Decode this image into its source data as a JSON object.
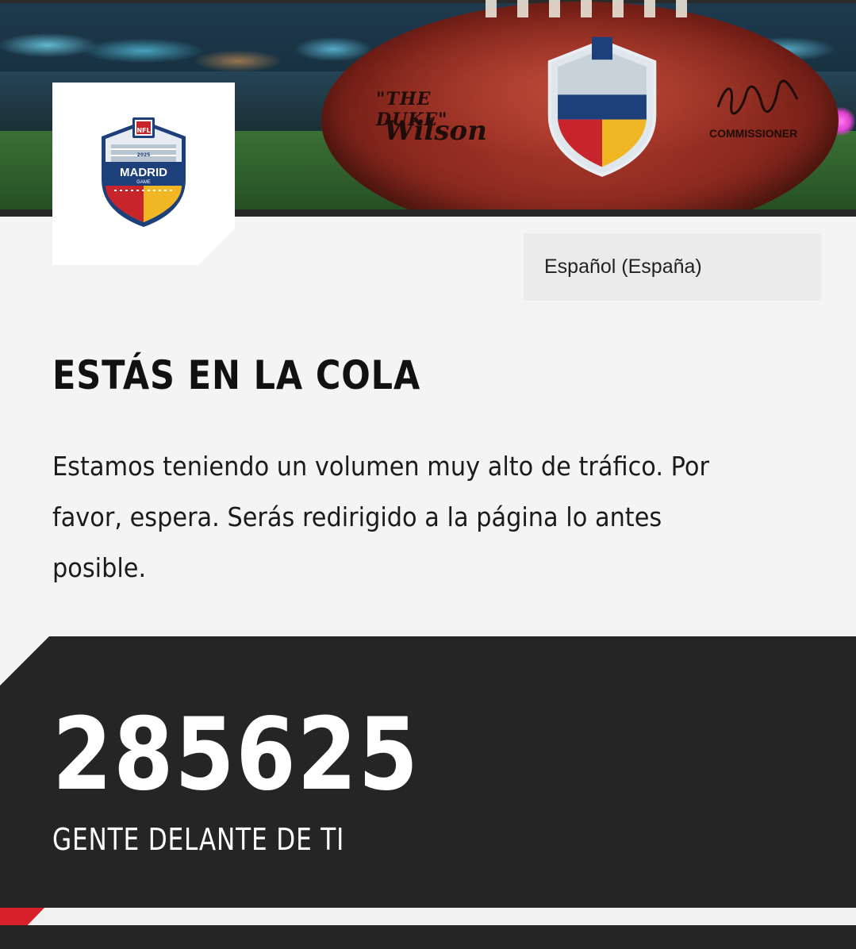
{
  "hero": {
    "ball_text_duke": "\"THE DUKE\"",
    "ball_text_wilson": "Wilson",
    "ball_text_commissioner": "COMMISSIONER"
  },
  "logo": {
    "league": "NFL",
    "year": "2025",
    "city": "MADRID",
    "subtitle": "GAME"
  },
  "language_selector": {
    "selected": "Español (España)"
  },
  "queue": {
    "title": "ESTÁS EN LA COLA",
    "message": "Estamos teniendo un volumen muy alto de tráfico. Por favor, espera. Serás redirigido a la página lo antes posible.",
    "people_ahead": "285625",
    "people_ahead_label": "GENTE DELANTE DE TI"
  },
  "colors": {
    "background": "#f4f4f4",
    "panel_dark": "#252525",
    "accent_red": "#d6202a",
    "logo_blue": "#1d3f7a"
  }
}
